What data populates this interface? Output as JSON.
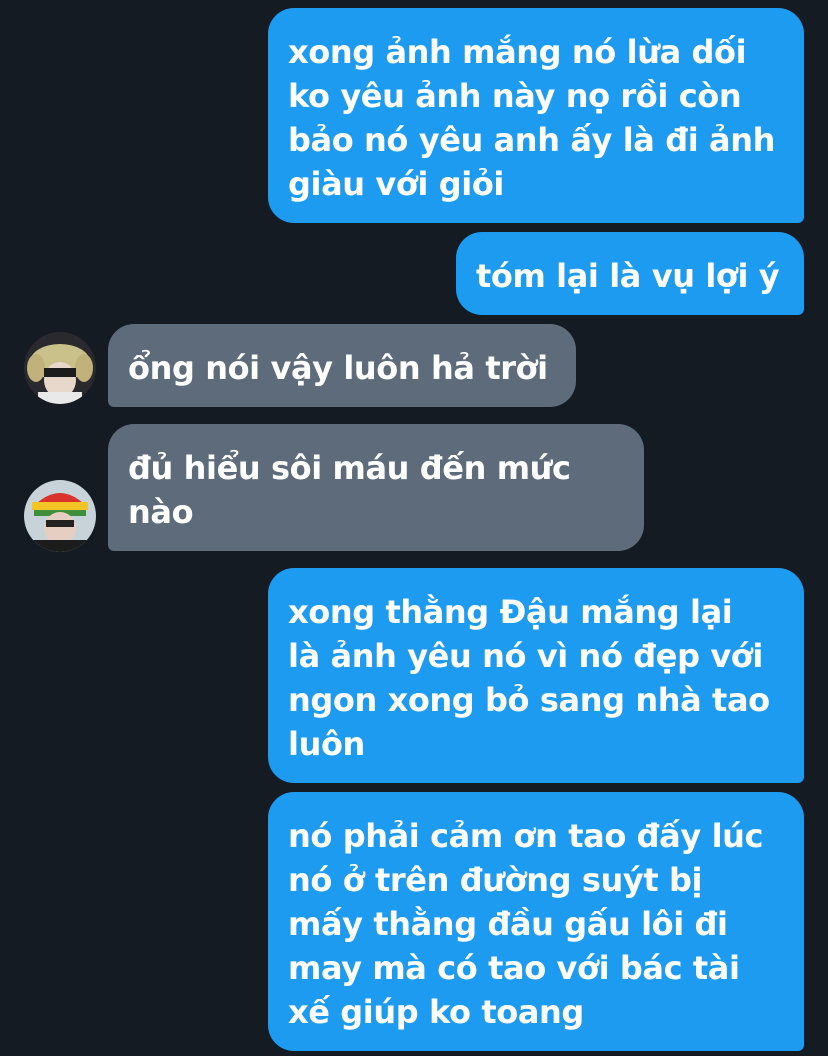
{
  "conversation": {
    "messages": [
      {
        "sender": "me",
        "lines": [
          "xong ảnh mắng nó lừa dối",
          "ko yêu ảnh này nọ rồi còn",
          "bảo nó yêu anh ấy là đi ảnh",
          "giàu với giỏi"
        ]
      },
      {
        "sender": "me",
        "lines": [
          "tóm lại là vụ lợi ý"
        ]
      },
      {
        "sender": "other_1",
        "lines": [
          "ổng nói vậy luôn hả trời"
        ]
      },
      {
        "sender": "other_2",
        "lines": [
          "đủ hiểu sôi máu đến mức",
          "nào"
        ]
      },
      {
        "sender": "me",
        "lines": [
          "xong thằng Đậu mắng lại",
          "là ảnh yêu nó vì nó đẹp với",
          "ngon xong bỏ sang nhà tao",
          "luôn"
        ]
      },
      {
        "sender": "me",
        "lines": [
          "nó phải cảm ơn tao đấy lúc",
          "nó ở trên đường suýt bị",
          "mấy thằng đầu gấu lôi đi",
          "may mà có tao với bác tài",
          "xế giúp ko toang"
        ]
      }
    ]
  },
  "colors": {
    "background": "#151b23",
    "sent_bubble": "#1d9bf0",
    "received_bubble": "#5d6b7a",
    "text": "#ffffff"
  },
  "icons": {
    "avatar_1": "user-avatar-icon",
    "avatar_2": "user-avatar-icon"
  }
}
